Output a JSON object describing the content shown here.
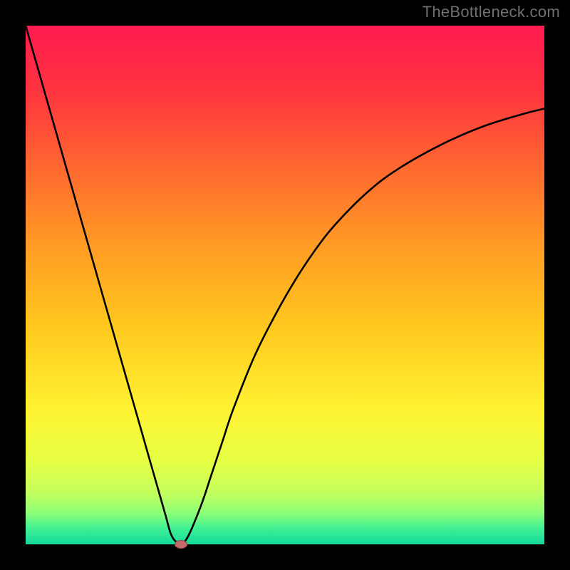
{
  "watermark": {
    "text": "TheBottleneck.com"
  },
  "colors": {
    "gradient_stops": [
      {
        "pct": 0,
        "hex": "#ff1a4f"
      },
      {
        "pct": 12,
        "hex": "#ff3340"
      },
      {
        "pct": 28,
        "hex": "#ff6a2f"
      },
      {
        "pct": 42,
        "hex": "#ff9a24"
      },
      {
        "pct": 58,
        "hex": "#ffc81e"
      },
      {
        "pct": 74,
        "hex": "#fff232"
      },
      {
        "pct": 84,
        "hex": "#e6ff44"
      },
      {
        "pct": 90,
        "hex": "#c4ff5d"
      },
      {
        "pct": 94,
        "hex": "#8cff78"
      },
      {
        "pct": 97,
        "hex": "#3fef94"
      },
      {
        "pct": 100,
        "hex": "#14da9c"
      }
    ],
    "curve": "#000000",
    "marker_fill": "#c46a6a",
    "marker_stroke": "#8a4a4a",
    "background": "#000000"
  },
  "chart_data": {
    "type": "line",
    "title": "",
    "xlabel": "",
    "ylabel": "",
    "xlim": [
      0,
      100
    ],
    "ylim": [
      0,
      100
    ],
    "curve": {
      "name": "bottleneck-curve",
      "x": [
        0,
        2,
        4,
        6,
        8,
        10,
        12,
        14,
        16,
        18,
        20,
        22,
        24,
        26,
        27,
        28,
        29,
        30,
        31,
        32,
        34,
        36,
        38,
        40,
        44,
        48,
        52,
        56,
        60,
        66,
        72,
        80,
        88,
        96,
        100
      ],
      "y": [
        100,
        93,
        86,
        79,
        72,
        65,
        58,
        51,
        44,
        37,
        30,
        23,
        16,
        9,
        5.5,
        2,
        0.5,
        0,
        1,
        3,
        8,
        14,
        20,
        26,
        36,
        44,
        51,
        57,
        62,
        68,
        72.5,
        77,
        80.5,
        83,
        84
      ]
    },
    "marker": {
      "x": 30,
      "y": 0,
      "rx": 9,
      "ry": 6
    }
  }
}
